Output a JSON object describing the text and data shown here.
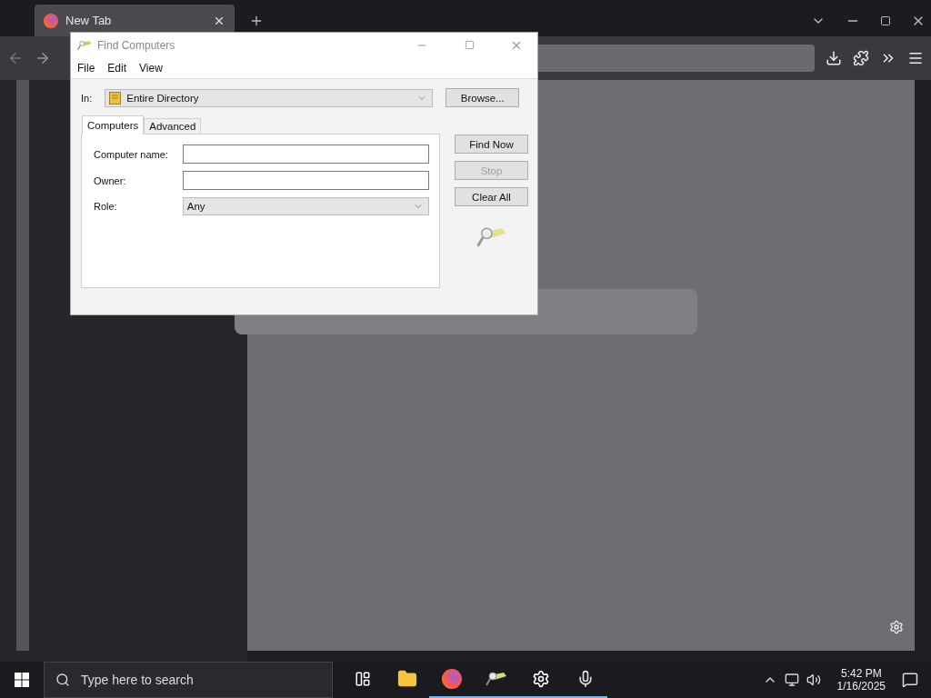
{
  "browser": {
    "tabs": [
      {
        "label": "New Tab",
        "selected": true
      }
    ]
  },
  "dialog": {
    "title": "Find Computers",
    "menu": [
      "File",
      "Edit",
      "View"
    ],
    "scope": {
      "label": "In:",
      "value": "Entire Directory"
    },
    "browse_button": "Browse...",
    "tabs": [
      {
        "label": "Computers",
        "selected": true
      },
      {
        "label": "Advanced",
        "selected": false
      }
    ],
    "fields": [
      {
        "kind": "text",
        "label": "Computer name:"
      },
      {
        "kind": "text",
        "label": "Owner:"
      },
      {
        "kind": "select",
        "label": "Role:",
        "value": "Any"
      }
    ],
    "buttons": [
      {
        "label": "Find Now",
        "disabled": false
      },
      {
        "label": "Stop",
        "disabled": true
      },
      {
        "label": "Clear All",
        "disabled": false
      }
    ]
  },
  "taskbar": {
    "search_placeholder": "Type here to search",
    "apps": [
      {
        "kind": "taskview",
        "running": false
      },
      {
        "kind": "folder",
        "running": false
      },
      {
        "kind": "firefox",
        "running": true
      },
      {
        "kind": "finder",
        "running": true
      },
      {
        "kind": "settings",
        "running": true
      },
      {
        "kind": "mic",
        "running": true
      }
    ],
    "time": "5:42 PM",
    "date": "1/16/2025"
  }
}
